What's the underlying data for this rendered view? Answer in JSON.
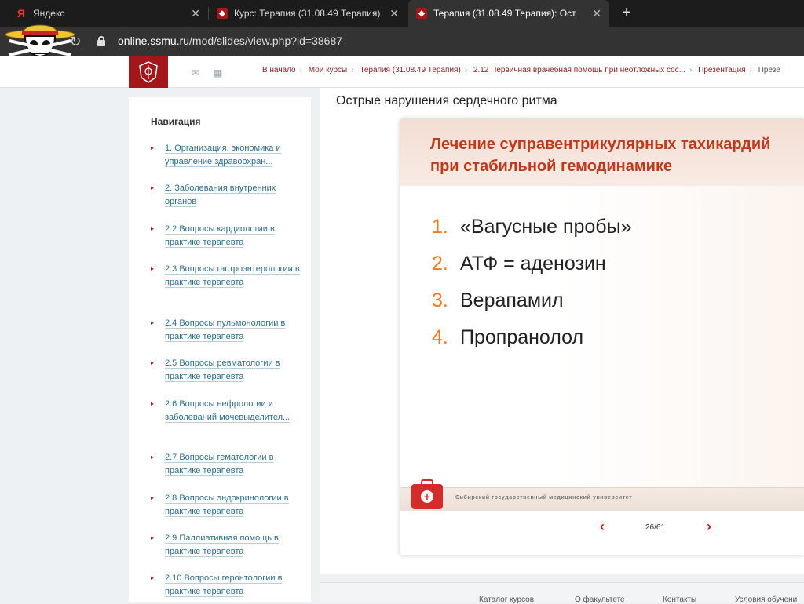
{
  "browser": {
    "tabs": [
      {
        "label": "Яндекс"
      },
      {
        "label": "Курс: Терапия (31.08.49 Терапия)"
      },
      {
        "label": "Терапия (31.08.49 Терапия): Ост"
      }
    ],
    "url_domain": "online.ssmu.ru",
    "url_path": "/mod/slides/view.php?id=38687"
  },
  "breadcrumb": [
    "В начало",
    "Мои курсы",
    "Терапия (31.08.49 Терапия)",
    "2.12 Первичная врачебная помощь при неотложных сос...",
    "Презентация",
    "Презе"
  ],
  "sidebar": {
    "title": "Навигация",
    "items": [
      {
        "label": "1. Организация, экономика и управление здравоохран..."
      },
      {
        "label": "2. Заболевания внутренних органов"
      },
      {
        "label": "2.2 Вопросы кардиологии в практике терапевта"
      },
      {
        "label": "2.3 Вопросы гастроэнтерологии в практике терапевта"
      },
      {
        "label": "2.4 Вопросы пульмонологии в практике терапевта"
      },
      {
        "label": "2.5 Вопросы ревматологии в практике терапевта"
      },
      {
        "label": "2.6 Вопросы нефрологии и заболеваний мочевыделител..."
      },
      {
        "label": "2.7 Вопросы гематологии в практике терапевта"
      },
      {
        "label": "2.8 Вопросы эндокринологии в практике терапевта"
      },
      {
        "label": "2.9 Паллиативная помощь в практике терапевта"
      },
      {
        "label": "2.10 Вопросы геронтологии в практике терапевта"
      }
    ]
  },
  "main": {
    "title": "Острые нарушения сердечного ритма",
    "slide": {
      "heading": "Лечение суправентрикулярных тахикардий при стабильной гемодинамике",
      "items": [
        {
          "num": "1.",
          "text": "«Вагусные пробы»"
        },
        {
          "num": "2.",
          "text": "АТФ = аденозин"
        },
        {
          "num": "3.",
          "text": "Верапамил"
        },
        {
          "num": "4.",
          "text": "Пропранолол"
        }
      ],
      "footer_text": "Сибирский государственный медицинский университет"
    },
    "pager": {
      "current": "26/61"
    }
  },
  "footer": {
    "links": [
      "Каталог курсов",
      "О факультете",
      "Контакты",
      "Условия обучени"
    ]
  },
  "colors": {
    "brand": "#a3161a",
    "accent": "#ee7a22",
    "heading": "#c0391b"
  }
}
